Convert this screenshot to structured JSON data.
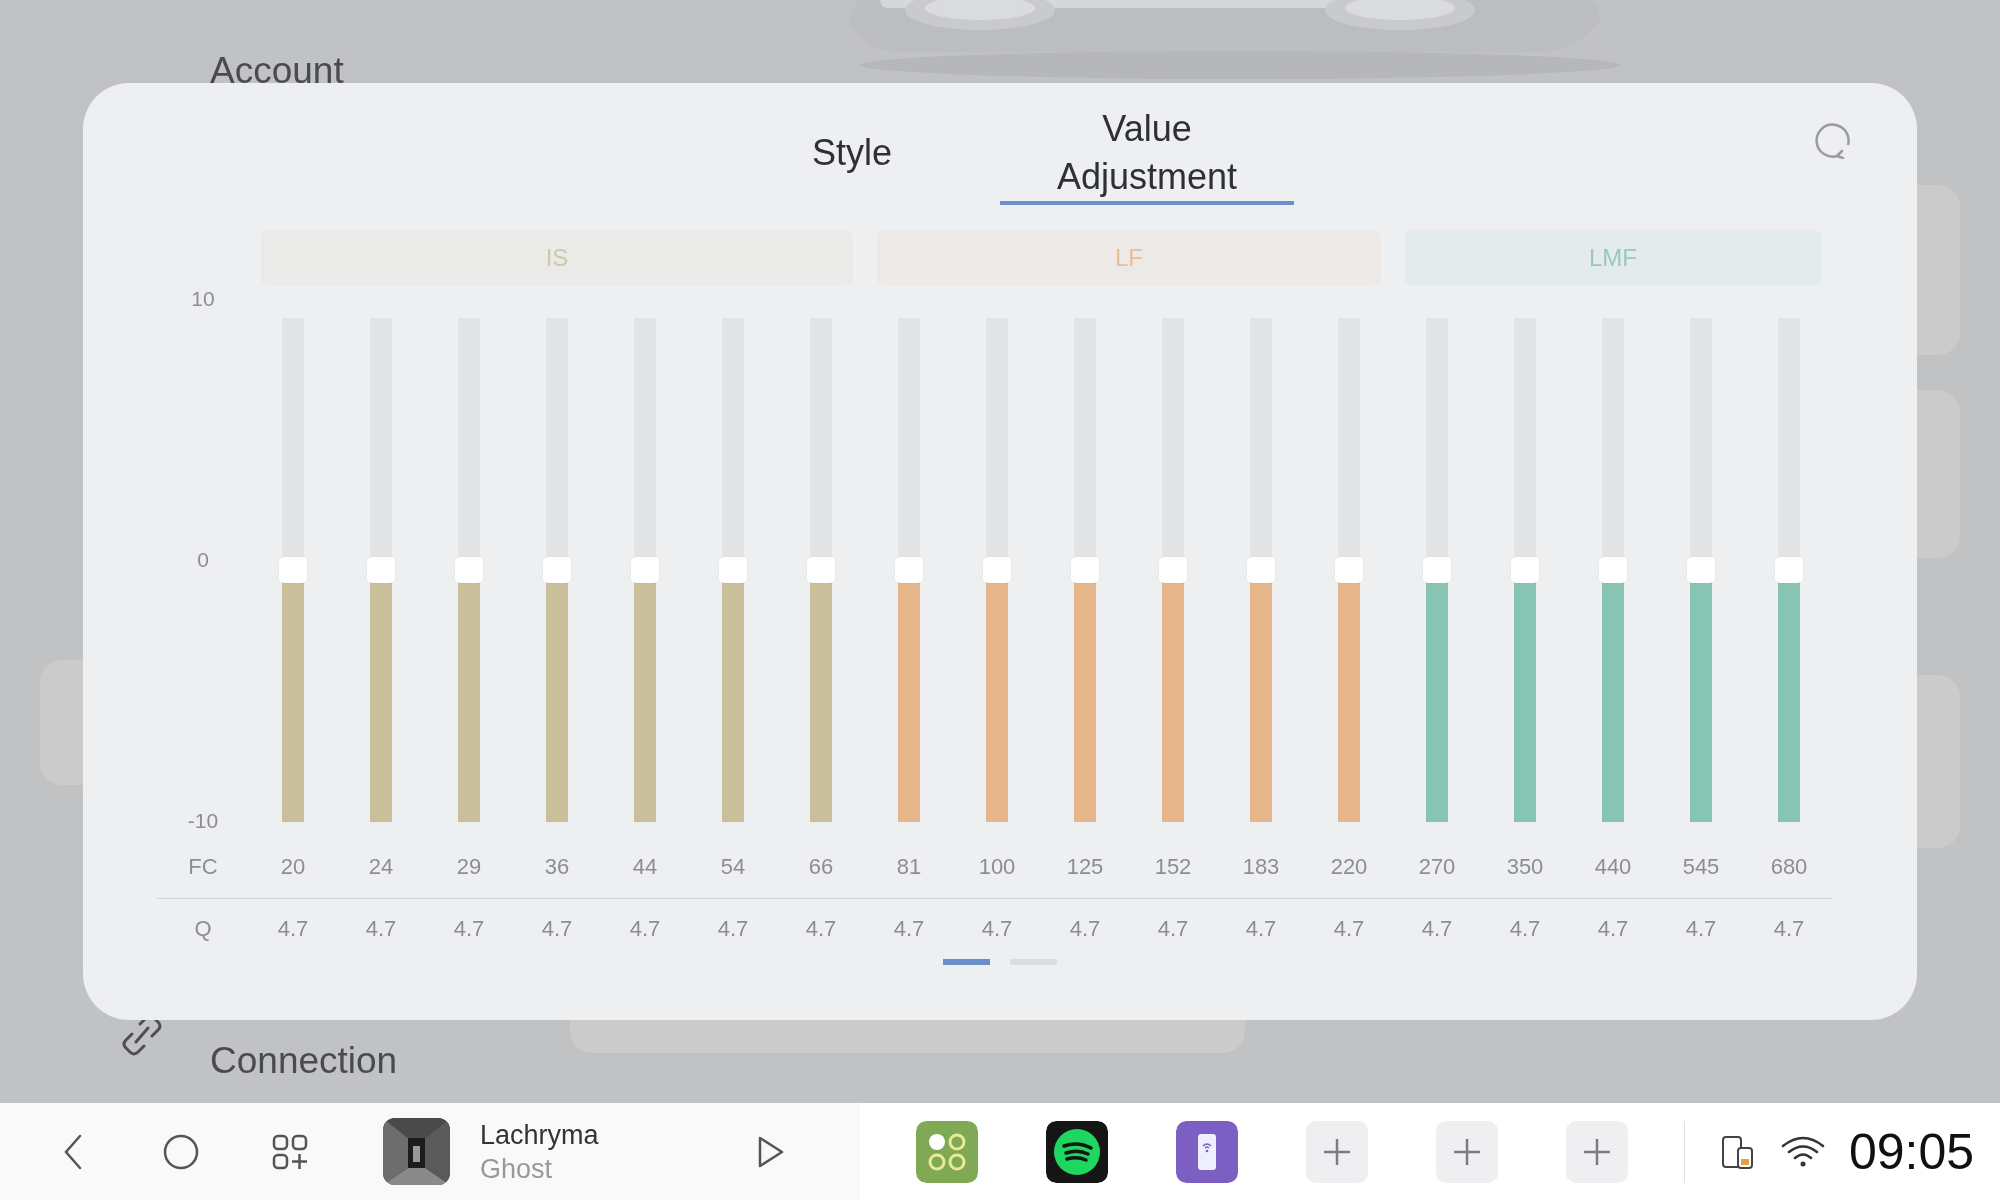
{
  "background": {
    "items": [
      {
        "kind": "heading",
        "text": "Account"
      },
      {
        "kind": "heading",
        "text": "Connection"
      }
    ]
  },
  "dialog": {
    "tabs": [
      {
        "label": "Style",
        "selected": false
      },
      {
        "label": "Value Adjustment",
        "selected": true
      }
    ],
    "axis": {
      "labels": [
        "10",
        "0",
        "-10"
      ],
      "fc_label": "FC",
      "q_label": "Q"
    },
    "bands": [
      {
        "label": "IS",
        "color": "#c9c09b",
        "sliders": [
          {
            "fc": "20",
            "q": "4.7",
            "level": 0.5
          },
          {
            "fc": "24",
            "q": "4.7",
            "level": 0.5
          },
          {
            "fc": "29",
            "q": "4.7",
            "level": 0.5
          },
          {
            "fc": "36",
            "q": "4.7",
            "level": 0.5
          },
          {
            "fc": "44",
            "q": "4.7",
            "level": 0.5
          },
          {
            "fc": "54",
            "q": "4.7",
            "level": 0.5
          },
          {
            "fc": "66",
            "q": "4.7",
            "level": 0.5
          }
        ]
      },
      {
        "label": "LF",
        "color": "#e4b68a",
        "sliders": [
          {
            "fc": "81",
            "q": "4.7",
            "level": 0.5
          },
          {
            "fc": "100",
            "q": "4.7",
            "level": 0.5
          },
          {
            "fc": "125",
            "q": "4.7",
            "level": 0.5
          },
          {
            "fc": "152",
            "q": "4.7",
            "level": 0.5
          },
          {
            "fc": "183",
            "q": "4.7",
            "level": 0.5
          },
          {
            "fc": "220",
            "q": "4.7",
            "level": 0.5
          }
        ]
      },
      {
        "label": "LMF",
        "color": "#88c4b4",
        "sliders": [
          {
            "fc": "270",
            "q": "4.7",
            "level": 0.5
          },
          {
            "fc": "350",
            "q": "4.7",
            "level": 0.5
          },
          {
            "fc": "440",
            "q": "4.7",
            "level": 0.5
          },
          {
            "fc": "545",
            "q": "4.7",
            "level": 0.5
          },
          {
            "fc": "680",
            "q": "4.7",
            "level": 0.5
          }
        ]
      }
    ],
    "pages": [
      {
        "selected": true
      },
      {
        "selected": false
      }
    ]
  },
  "taskbar": {
    "media": {
      "title": "Lachryma",
      "artist": "Ghost"
    },
    "shortcuts": [
      {
        "kind": "tiles"
      },
      {
        "kind": "music"
      },
      {
        "kind": "phone"
      },
      {
        "kind": "add"
      },
      {
        "kind": "add"
      },
      {
        "kind": "add"
      }
    ],
    "clock": "09:05"
  }
}
